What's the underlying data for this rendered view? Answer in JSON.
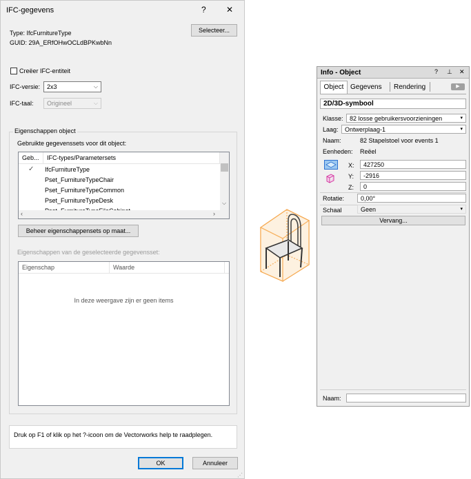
{
  "dialog": {
    "title": "IFC-gegevens",
    "help_glyph": "?",
    "close_glyph": "✕",
    "type_line": "Type:  IfcFurnitureType",
    "guid_line": "GUID:  29A_ERfOHwOCLdBPKwbNn",
    "select_button": "Selecteer...",
    "create_checkbox_label": "Creëer IFC-entiteit",
    "version_label": "IFC-versie:",
    "version_value": "2x3",
    "language_label": "IFC-taal:",
    "language_value": "Origineel",
    "group_title": "Eigenschappen object",
    "psets_label": "Gebruikte gegevenssets voor dit object:",
    "psets_headers": [
      "Geb...",
      "IFC-types/Parametersets"
    ],
    "psets_check": "✓",
    "psets_rows": [
      "IfcFurnitureType",
      "Pset_FurnitureTypeChair",
      "Pset_FurnitureTypeCommon",
      "Pset_FurnitureTypeDesk",
      "Pset_FurnitureTypeFileCabinet"
    ],
    "manage_button": "Beheer eigenschappensets op maat...",
    "selected_props_label": "Eigenschappen van de geselecteerde gegevensset:",
    "props_headers": [
      "Eigenschap",
      "Waarde"
    ],
    "props_empty": "In deze weergave zijn er geen items",
    "help_text": "Druk op F1 of klik op het ?-icoon om de Vectorworks help te raadplegen.",
    "ok_button": "OK",
    "cancel_button": "Annuleer"
  },
  "palette": {
    "title": "Info - Object",
    "tabs": [
      "Object",
      "Gegevens",
      "Rendering"
    ],
    "section": "2D/3D-symbool",
    "class_label": "Klasse:",
    "class_value": "82 losse gebruikersvoorzieningen",
    "layer_label": "Laag:",
    "layer_value": "Ontwerplaag-1",
    "name_label": "Naam:",
    "name_value": "82 Stapelstoel voor events 1",
    "units_label": "Eenheden:",
    "units_value": "Reëel",
    "x_label": "X:",
    "x_value": "427250",
    "y_label": "Y:",
    "y_value": "-2916",
    "z_label": "Z:",
    "z_value": "0",
    "rotation_label": "Rotatie:",
    "rotation_value": "0,00°",
    "scale_label": "Schaal",
    "scale_value": "Geen",
    "replace_button": "Vervang...",
    "bottom_name_label": "Naam:",
    "bottom_name_value": ""
  },
  "colors": {
    "accent": "#0078d7",
    "chair_highlight": "#f5a040"
  }
}
